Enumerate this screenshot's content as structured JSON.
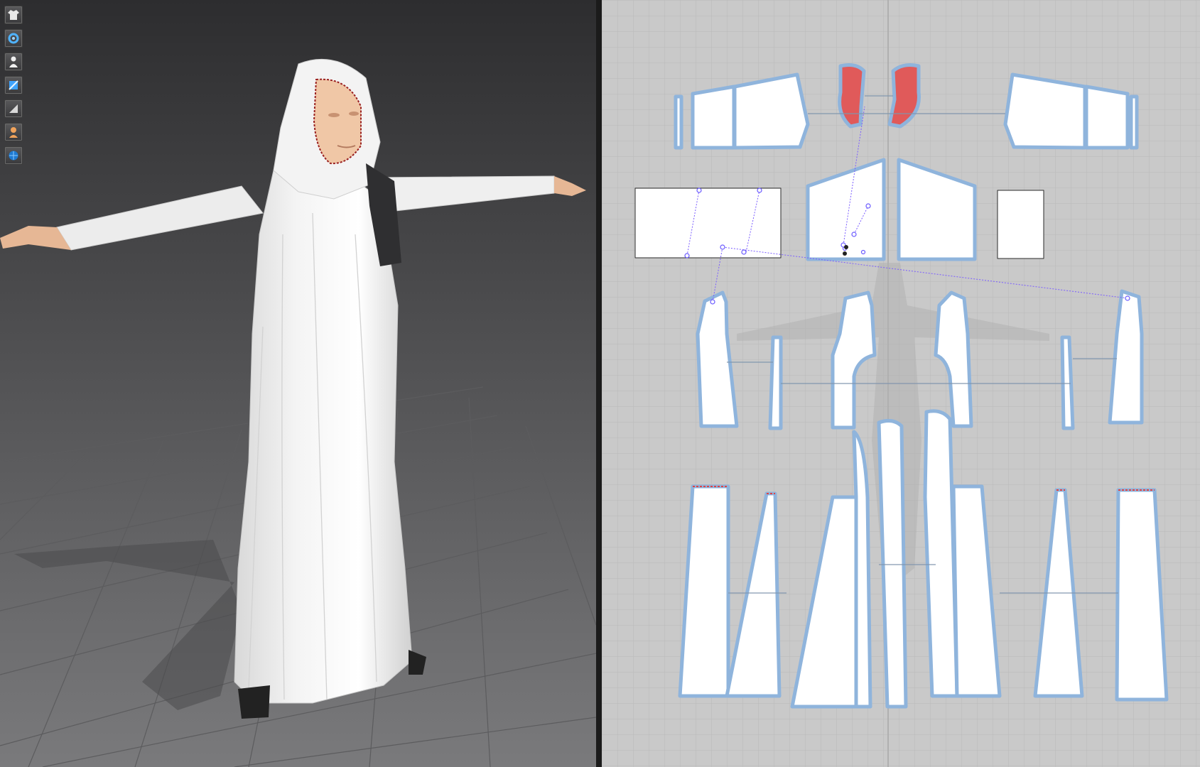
{
  "app": {
    "panels": [
      "3d-view",
      "2d-pattern-view"
    ]
  },
  "toolbar": {
    "items": [
      {
        "icon": "garment-icon"
      },
      {
        "icon": "simulation-icon"
      },
      {
        "icon": "avatar-icon"
      },
      {
        "icon": "fabric-icon"
      },
      {
        "icon": "render-icon"
      },
      {
        "icon": "skin-icon"
      },
      {
        "icon": "environment-icon"
      }
    ]
  },
  "colors": {
    "pattern_outline": "#8fb4dc",
    "pattern_fill": "#ffffff",
    "selected_piece": "#e05a5a",
    "grid_background": "#c9c9c9",
    "viewport_background": "#4c4c4e"
  }
}
